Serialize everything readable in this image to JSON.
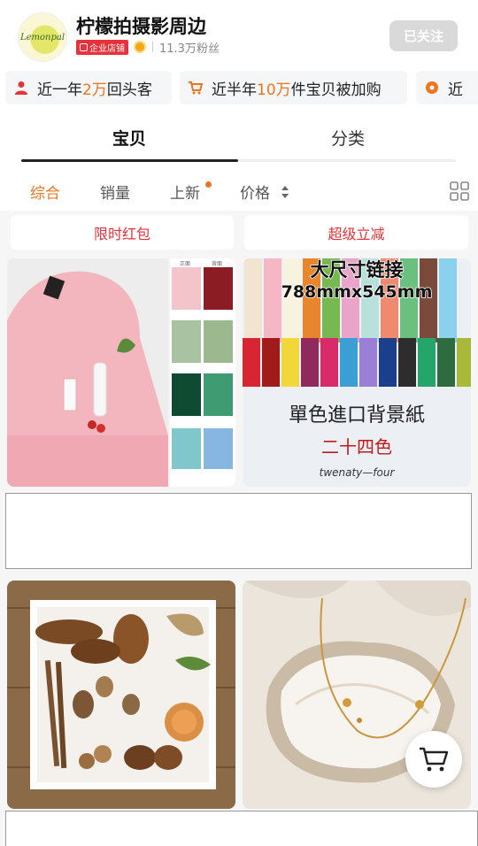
{
  "shop": {
    "logo_text": "Lemonpal",
    "name": "柠檬拍摄影周边",
    "badge": "企业店铺",
    "fans": "11.3万粉丝",
    "follow_label": "已关注"
  },
  "promos": [
    {
      "prefix": "近一年",
      "highlight": "2万",
      "suffix": "回头客",
      "icon": "user-icon"
    },
    {
      "prefix": "近半年",
      "highlight": "10万",
      "suffix": "件宝贝被加购",
      "icon": "cart-icon"
    },
    {
      "prefix": "近",
      "highlight": "",
      "suffix": "",
      "icon": "flower-icon"
    }
  ],
  "tabs": [
    {
      "label": "宝贝",
      "active": true
    },
    {
      "label": "分类",
      "active": false
    }
  ],
  "sort": [
    {
      "label": "综合",
      "active": true
    },
    {
      "label": "销量",
      "active": false
    },
    {
      "label": "上新",
      "active": false,
      "dot": true
    },
    {
      "label": "价格",
      "active": false,
      "arrows": true
    }
  ],
  "coupons": [
    "限时红包",
    "超级立减"
  ],
  "products": [
    {
      "image": "pink-backdrop-with-color-swatches",
      "swatch_labels": [
        "正面",
        "背面"
      ]
    },
    {
      "image": "paper-rolls",
      "overlay_title": "大尺寸链接",
      "overlay_size": "788mmx545mm",
      "caption_main": "單色進口背景紙",
      "caption_sub": "二十四色",
      "caption_en": "twenaty—four"
    },
    {
      "image": "pinecones-tray"
    },
    {
      "image": "oyster-shell-necklace"
    }
  ],
  "colors": {
    "accent": "#f0741e",
    "red": "#e8313a",
    "follow_bg": "#d9d9d9"
  }
}
